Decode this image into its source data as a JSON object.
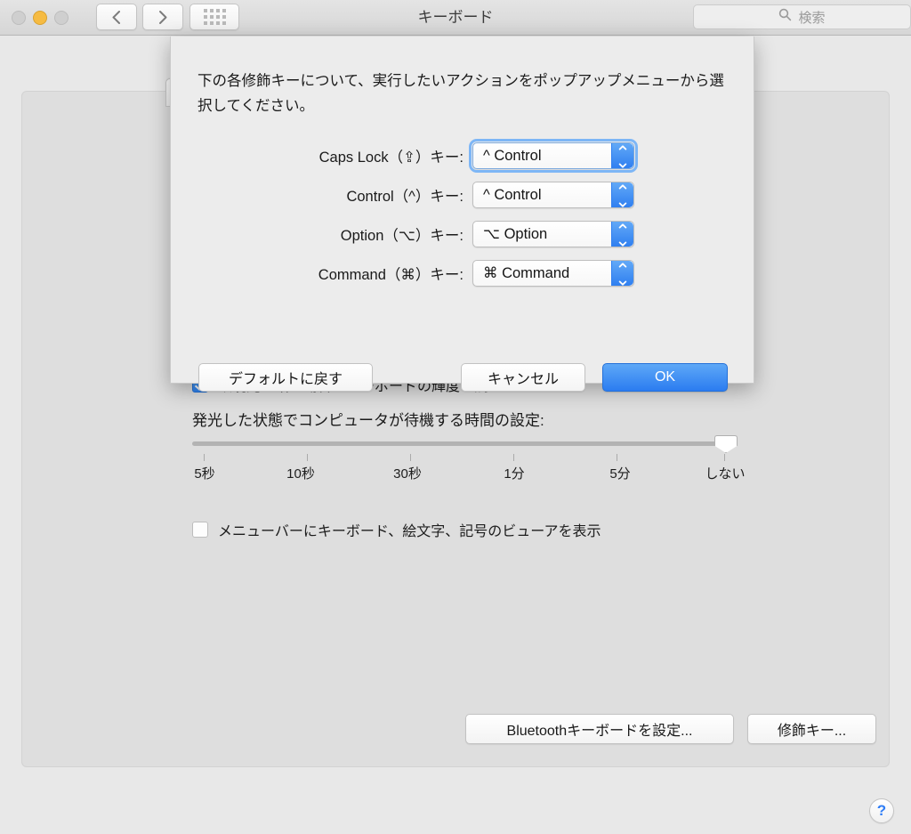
{
  "window": {
    "title": "キーボード",
    "traffic_lights": [
      "close",
      "minimize",
      "zoom"
    ],
    "nav_back_icon": "chevron-left-icon",
    "nav_forward_icon": "chevron-right-icon",
    "show_all_icon": "grid-icon",
    "search": {
      "placeholder": "検索",
      "value": "",
      "icon": "search-icon"
    }
  },
  "sheet": {
    "description": "下の各修飾キーについて、実行したいアクションをポップアップメニューから選択してください。",
    "rows": [
      {
        "label": "Caps Lock（⇪）キー:",
        "value": "^ Control",
        "focused": true
      },
      {
        "label": "Control（^）キー:",
        "value": "^ Control",
        "focused": false
      },
      {
        "label": "Option（⌥）キー:",
        "value": "⌥ Option",
        "focused": false
      },
      {
        "label": "Command（⌘）キー:",
        "value": "⌘ Command",
        "focused": false
      }
    ],
    "buttons": {
      "defaults": "デフォルトに戻す",
      "cancel": "キャンセル",
      "ok": "OK"
    }
  },
  "background": {
    "illumination_checkbox": {
      "label": "環境光が暗い場合にキーボードの輝度を調整",
      "checked": true
    },
    "slider_title": "発光した状態でコンピュータが待機する時間の設定:",
    "slider": {
      "ticks": [
        "5秒",
        "10秒",
        "30秒",
        "1分",
        "5分",
        "しない"
      ],
      "value": "しない",
      "value_index": 5
    },
    "viewer_checkbox": {
      "label": "メニューバーにキーボード、絵文字、記号のビューアを表示",
      "checked": false
    },
    "buttons": {
      "bluetooth": "Bluetoothキーボードを設定...",
      "modifier": "修飾キー..."
    },
    "help_label": "?"
  },
  "colors": {
    "accent_blue": "#2f7ff0",
    "sheet_bg": "#ececec",
    "panel_bg": "#dedede",
    "window_bg": "#e8e8e8"
  }
}
